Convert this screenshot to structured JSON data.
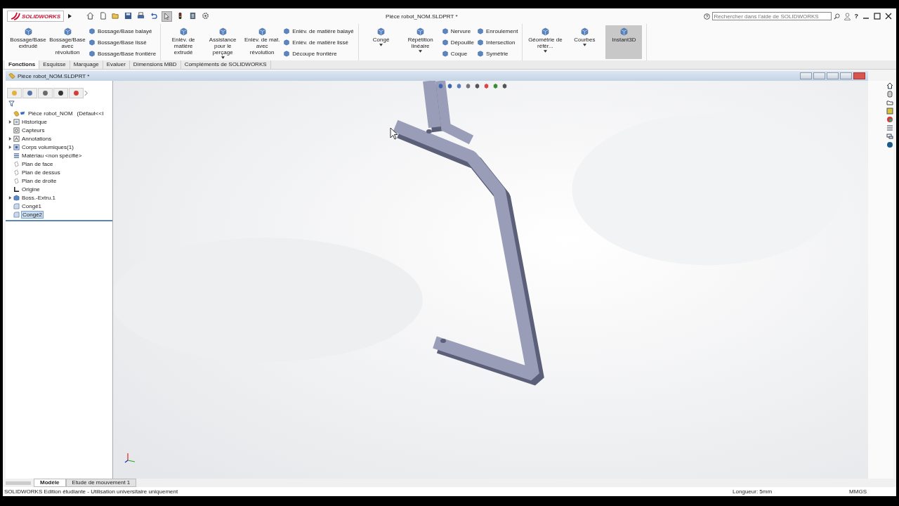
{
  "app": {
    "logo": "SOLIDWORKS",
    "title": "Pièce robot_NOM.SLDPRT *",
    "search": {
      "placeholder": "Rechercher dans l'aide de SOLIDWORKS"
    },
    "help": "?"
  },
  "quick_access": [
    {
      "kind": "home",
      "selected": false
    },
    {
      "kind": "new",
      "selected": false
    },
    {
      "kind": "open",
      "selected": false
    },
    {
      "kind": "save",
      "selected": false
    },
    {
      "kind": "print",
      "selected": false
    },
    {
      "kind": "undo",
      "selected": false
    },
    {
      "kind": "select",
      "selected": true
    },
    {
      "kind": "rebuild",
      "selected": false
    },
    {
      "kind": "file-props",
      "selected": false
    },
    {
      "kind": "options",
      "selected": false
    }
  ],
  "ribbon": [
    [
      {
        "kind": "large",
        "label": "Bossage/Base extrudé",
        "dropdown": false,
        "selected": false
      },
      {
        "kind": "large",
        "label": "Bossage/Base avec révolution",
        "dropdown": false,
        "selected": false
      },
      {
        "kind": "stack",
        "items": [
          "Bossage/Base balayé",
          "Bossage/Base lissé",
          "Bossage/Base frontière"
        ]
      }
    ],
    [
      {
        "kind": "large",
        "label": "Enlèv. de matière extrudé",
        "dropdown": false,
        "selected": false
      },
      {
        "kind": "large",
        "label": "Assistance pour le perçage",
        "dropdown": true,
        "selected": false
      },
      {
        "kind": "large",
        "label": "Enlèv. de mat. avec révolution",
        "dropdown": false,
        "selected": false
      },
      {
        "kind": "stack",
        "items": [
          "Enlèv. de matière balayé",
          "Enlèv. de matière lissé",
          "Découpe frontière"
        ]
      }
    ],
    [
      {
        "kind": "large",
        "label": "Congé",
        "dropdown": true,
        "selected": false
      },
      {
        "kind": "large",
        "label": "Répétition linéaire",
        "dropdown": true,
        "selected": false
      },
      {
        "kind": "stack",
        "items": [
          "Nervure",
          "Dépouille",
          "Coque"
        ]
      },
      {
        "kind": "stack",
        "items": [
          "Enroulement",
          "Intersection",
          "Symétrie"
        ]
      }
    ],
    [
      {
        "kind": "large",
        "label": "Géométrie de référ...",
        "dropdown": true,
        "selected": false
      },
      {
        "kind": "large",
        "label": "Courbes",
        "dropdown": true,
        "selected": false
      },
      {
        "kind": "large",
        "label": "Instant3D",
        "dropdown": false,
        "selected": true
      }
    ]
  ],
  "command_tabs": [
    {
      "label": "Fonctions",
      "selected": true
    },
    {
      "label": "Esquisse",
      "selected": false
    },
    {
      "label": "Marquage",
      "selected": false
    },
    {
      "label": "Evaluer",
      "selected": false
    },
    {
      "label": "Dimensions MBD",
      "selected": false
    },
    {
      "label": "Compléments de SOLIDWORKS",
      "selected": false
    }
  ],
  "document": {
    "title": "Pièce robot_NOM.SLDPRT *"
  },
  "feature_tree": {
    "root": {
      "label": "Pièce robot_NOM",
      "config": "(Défaut<<I",
      "children": [
        {
          "label": "Historique",
          "kind": "folder",
          "expanded": false,
          "selected": false
        },
        {
          "label": "Capteurs",
          "kind": "sensor",
          "selected": false
        },
        {
          "label": "Annotations",
          "kind": "annotation",
          "expanded": false,
          "selected": false
        },
        {
          "label": "Corps volumiques(1)",
          "kind": "body",
          "expanded": false,
          "selected": false
        },
        {
          "label": "Matériau <non spécifié>",
          "kind": "material",
          "selected": false
        },
        {
          "label": "Plan de face",
          "kind": "plane",
          "selected": false
        },
        {
          "label": "Plan de dessus",
          "kind": "plane",
          "selected": false
        },
        {
          "label": "Plan de droite",
          "kind": "plane",
          "selected": false
        },
        {
          "label": "Origine",
          "kind": "origin",
          "selected": false
        },
        {
          "label": "Boss.-Extru.1",
          "kind": "extrude",
          "expanded": false,
          "selected": false
        },
        {
          "label": "Congé1",
          "kind": "fillet",
          "selected": false
        },
        {
          "label": "Congé2",
          "kind": "fillet",
          "selected": true
        }
      ]
    }
  },
  "bottom_tabs": [
    {
      "label": "Modèle",
      "selected": true
    },
    {
      "label": "Etude de mouvement 1",
      "selected": false
    }
  ],
  "status_bar": {
    "text": "SOLIDWORKS Edition étudiante - Utilisation universitaire uniquement",
    "measure": "Longueur: 5mm",
    "units": "MMGS"
  }
}
